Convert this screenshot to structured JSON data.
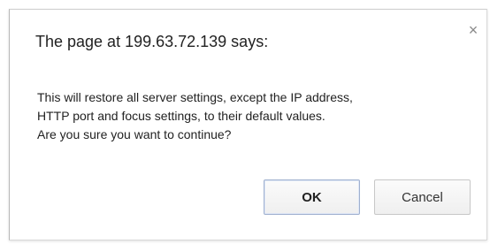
{
  "dialog": {
    "title": "The page at 199.63.72.139 says:",
    "close_icon": "close-icon",
    "close_glyph": "×",
    "message_lines": [
      "This will restore all server settings, except the IP address,",
      "HTTP port and focus settings, to their default values.",
      "Are you sure you want to continue?"
    ],
    "buttons": {
      "ok_label": "OK",
      "cancel_label": "Cancel"
    }
  }
}
